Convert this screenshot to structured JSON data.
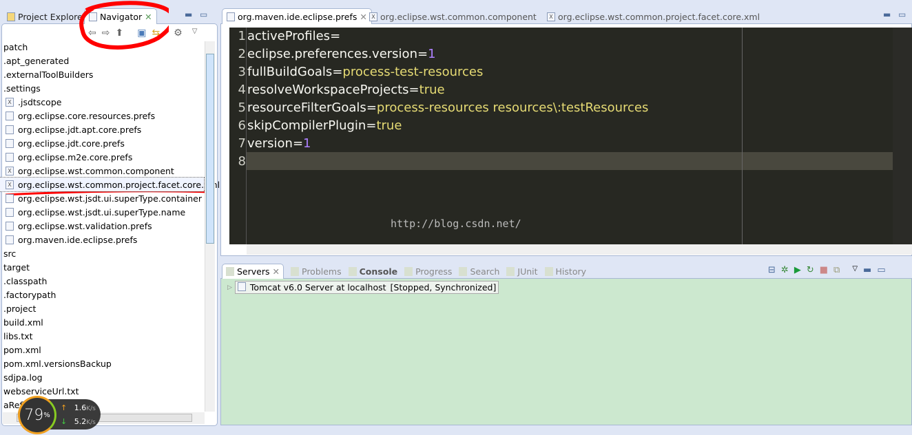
{
  "left_panel": {
    "tabs": [
      {
        "label": "Project Explorer"
      },
      {
        "label": "Navigator"
      }
    ],
    "toolbar": [
      "back-icon",
      "forward-icon",
      "up-icon",
      "collapse-all-icon",
      "link-editor-icon",
      "filter-icon",
      "view-menu-icon"
    ],
    "items": [
      {
        "label": "patch",
        "icon": "",
        "indent": 0
      },
      {
        "label": ".apt_generated",
        "icon": "",
        "indent": 0
      },
      {
        "label": ".externalToolBuilders",
        "icon": "",
        "indent": 0
      },
      {
        "label": ".settings",
        "icon": "",
        "indent": 0
      },
      {
        "label": ".jsdtscope",
        "icon": "xml",
        "indent": 1
      },
      {
        "label": "org.eclipse.core.resources.prefs",
        "icon": "file",
        "indent": 1
      },
      {
        "label": "org.eclipse.jdt.apt.core.prefs",
        "icon": "file",
        "indent": 1
      },
      {
        "label": "org.eclipse.jdt.core.prefs",
        "icon": "file",
        "indent": 1
      },
      {
        "label": "org.eclipse.m2e.core.prefs",
        "icon": "file",
        "indent": 1
      },
      {
        "label": "org.eclipse.wst.common.component",
        "icon": "xml",
        "indent": 1
      },
      {
        "label": "org.eclipse.wst.common.project.facet.core.xml",
        "icon": "xml",
        "indent": 1,
        "selected": true
      },
      {
        "label": "org.eclipse.wst.jsdt.ui.superType.container",
        "icon": "file",
        "indent": 1
      },
      {
        "label": "org.eclipse.wst.jsdt.ui.superType.name",
        "icon": "file",
        "indent": 1
      },
      {
        "label": "org.eclipse.wst.validation.prefs",
        "icon": "file",
        "indent": 1
      },
      {
        "label": "org.maven.ide.eclipse.prefs",
        "icon": "file",
        "indent": 1
      },
      {
        "label": "src",
        "icon": "",
        "indent": 0
      },
      {
        "label": "target",
        "icon": "",
        "indent": 0
      },
      {
        "label": ".classpath",
        "icon": "",
        "indent": 0
      },
      {
        "label": ".factorypath",
        "icon": "",
        "indent": 0
      },
      {
        "label": ".project",
        "icon": "",
        "indent": 0
      },
      {
        "label": "build.xml",
        "icon": "",
        "indent": 0
      },
      {
        "label": "libs.txt",
        "icon": "",
        "indent": 0
      },
      {
        "label": "pom.xml",
        "icon": "",
        "indent": 0
      },
      {
        "label": "pom.xml.versionsBackup",
        "icon": "",
        "indent": 0
      },
      {
        "label": "sdjpa.log",
        "icon": "",
        "indent": 0
      },
      {
        "label": "webserviceUrl.txt",
        "icon": "",
        "indent": 0
      },
      {
        "label": "aReflect",
        "icon": "",
        "indent": 0
      }
    ]
  },
  "editor": {
    "tabs": [
      {
        "label": "org.maven.ide.eclipse.prefs",
        "active": true
      },
      {
        "label": "org.eclipse.wst.common.component"
      },
      {
        "label": "org.eclipse.wst.common.project.facet.core.xml"
      }
    ],
    "lines": [
      {
        "n": "1",
        "key": "activeProfiles",
        "val": ""
      },
      {
        "n": "2",
        "key": "eclipse.preferences.version",
        "val": "1"
      },
      {
        "n": "3",
        "key": "fullBuildGoals",
        "val": "process-test-resources"
      },
      {
        "n": "4",
        "key": "resolveWorkspaceProjects",
        "val": "true"
      },
      {
        "n": "5",
        "key": "resourceFilterGoals",
        "val": "process-resources resources\\:testResources"
      },
      {
        "n": "6",
        "key": "skipCompilerPlugin",
        "val": "true"
      },
      {
        "n": "7",
        "key": "version",
        "val": "1"
      },
      {
        "n": "8",
        "key": "",
        "val": ""
      }
    ],
    "current_line": 8,
    "watermark": "http://blog.csdn.net/",
    "colors": {
      "background": "#272822",
      "key": "#f8f8f2",
      "value": "#e6db74",
      "number": "#ae81ff",
      "current_line": "#49483e"
    }
  },
  "bottom_panel": {
    "tabs": [
      {
        "label": "Servers",
        "active": true
      },
      {
        "label": "Problems"
      },
      {
        "label": "Console"
      },
      {
        "label": "Progress"
      },
      {
        "label": "Search"
      },
      {
        "label": "JUnit"
      },
      {
        "label": "History"
      }
    ],
    "server": {
      "name": "Tomcat v6.0 Server at localhost",
      "status": "[Stopped, Synchronized]"
    },
    "background": "#cce8cf"
  },
  "net_widget": {
    "percent": "79",
    "percent_sign": "%",
    "up": "1.6",
    "down": "5.2",
    "unit": "K/s"
  }
}
